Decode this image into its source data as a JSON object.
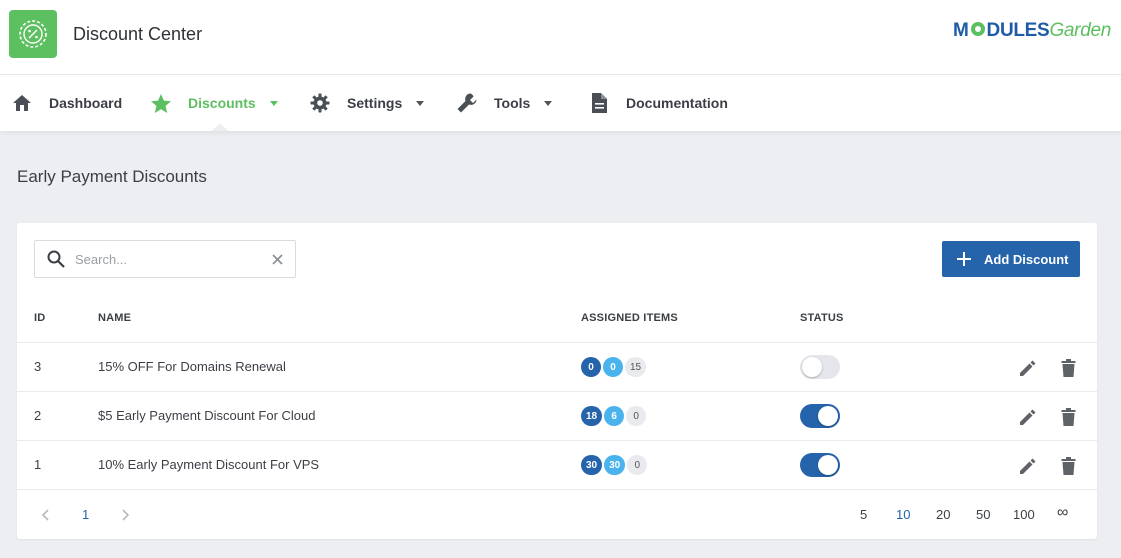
{
  "header": {
    "app_title": "Discount Center",
    "brand": {
      "part1": "M",
      "part2": "DULES",
      "part3": "Garden"
    }
  },
  "nav": {
    "items": [
      {
        "label": "Dashboard",
        "icon": "home-icon"
      },
      {
        "label": "Discounts",
        "icon": "star-icon",
        "active": true
      },
      {
        "label": "Settings",
        "icon": "gear-icon"
      },
      {
        "label": "Tools",
        "icon": "wrench-icon"
      },
      {
        "label": "Documentation",
        "icon": "document-icon"
      }
    ]
  },
  "page": {
    "title": "Early Payment Discounts"
  },
  "toolbar": {
    "search_placeholder": "Search...",
    "add_label": "Add Discount"
  },
  "table": {
    "headers": {
      "id": "ID",
      "name": "NAME",
      "assigned": "ASSIGNED ITEMS",
      "status": "STATUS"
    },
    "rows": [
      {
        "id": "3",
        "name": "15% OFF For Domains Renewal",
        "badges": [
          "0",
          "0",
          "15"
        ],
        "status": "off"
      },
      {
        "id": "2",
        "name": "$5 Early Payment Discount For Cloud",
        "badges": [
          "18",
          "6",
          "0"
        ],
        "status": "on"
      },
      {
        "id": "1",
        "name": "10% Early Payment Discount For VPS",
        "badges": [
          "30",
          "30",
          "0"
        ],
        "status": "on"
      }
    ]
  },
  "pagination": {
    "current_page": "1",
    "page_sizes": [
      "5",
      "10",
      "20",
      "50",
      "100",
      "∞"
    ],
    "active_size": "10"
  },
  "colors": {
    "accent_green": "#5cbf60",
    "primary_blue": "#2563ab",
    "light_blue": "#4ab3ee"
  }
}
